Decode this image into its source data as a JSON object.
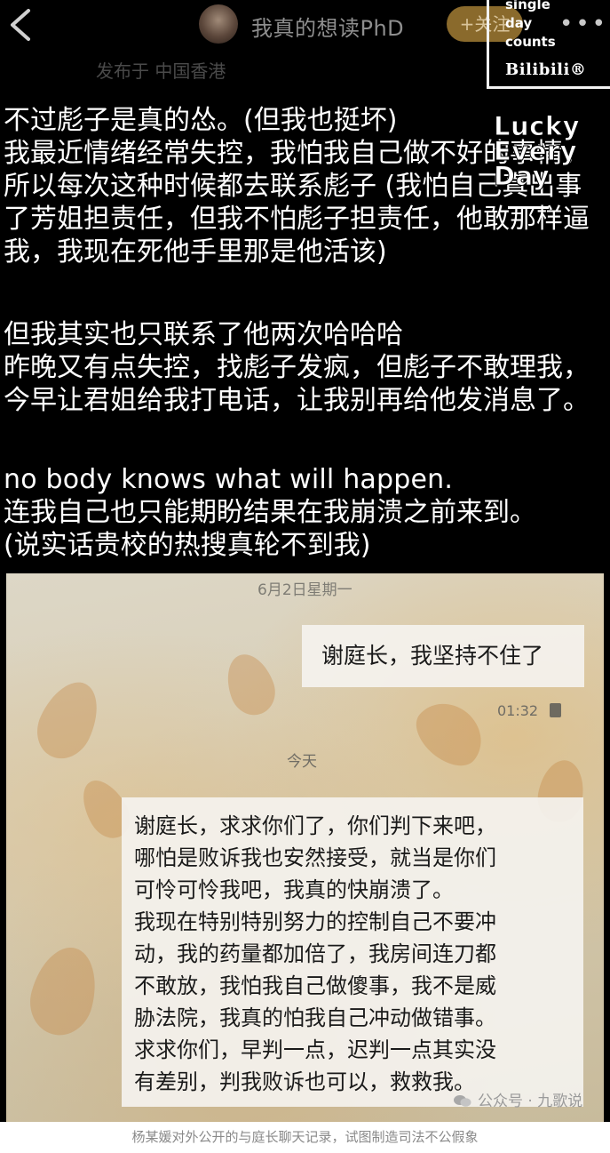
{
  "header": {
    "username": "我真的想读PhD",
    "follow_label": "+关注",
    "more_label": "•••",
    "location": "发布于 中国香港"
  },
  "watermarks": {
    "bilibili_lines": [
      "single",
      "day",
      "counts"
    ],
    "bilibili_brand": "Bilibili®",
    "lucky_lines": [
      "Lucky",
      "Every",
      "Day"
    ]
  },
  "post": {
    "para1": [
      "不过彪子是真的怂。(但我也挺坏)",
      "我最近情绪经常失控，我怕我自己做不好的事情，",
      "所以每次这种时候都去联系彪子 (我怕自己真出事",
      "了芳姐担责任，但我不怕彪子担责任，他敢那样逼",
      "我，我现在死他手里那是他活该)"
    ],
    "para2": [
      "但我其实也只联系了他两次哈哈哈",
      "昨晚又有点失控，找彪子发疯，但彪子不敢理我，",
      "今早让君姐给我打电话，让我别再给他发消息了。"
    ],
    "para3": [
      "no body knows what will happen.",
      "连我自己也只能期盼结果在我崩溃之前来到。",
      "(说实话贵校的热搜真轮不到我)"
    ]
  },
  "chat": {
    "date_label": "6月2日星期一",
    "outgoing_message": "谢庭长，我坚持不住了",
    "outgoing_time": "01:32",
    "today_label": "今天",
    "incoming_message_lines": [
      "谢庭长，求求你们了，你们判下来吧，",
      "哪怕是败诉我也安然接受，就当是你们",
      "可怜可怜我吧，我真的快崩溃了。",
      "我现在特别特别努力的控制自己不要冲",
      "动，我的药量都加倍了，我房间连刀都",
      "不敢放，我怕我自己做傻事，我不是威",
      "胁法院，我真的怕我自己冲动做错事。",
      "求求你们，早判一点，迟判一点其实没",
      "有差别，判我败诉也可以，救救我。"
    ]
  },
  "source_watermark": "公众号 · 九歌说",
  "caption": "杨某媛对外公开的与庭长聊天记录，试图制造司法不公假象",
  "colors": {
    "background": "#000000",
    "follow_button": "#8a6a2c",
    "bubble": "#f4f2ee"
  },
  "icons": [
    "back-arrow-icon",
    "more-dots-icon",
    "read-receipt-icon",
    "wechat-logo-icon"
  ]
}
